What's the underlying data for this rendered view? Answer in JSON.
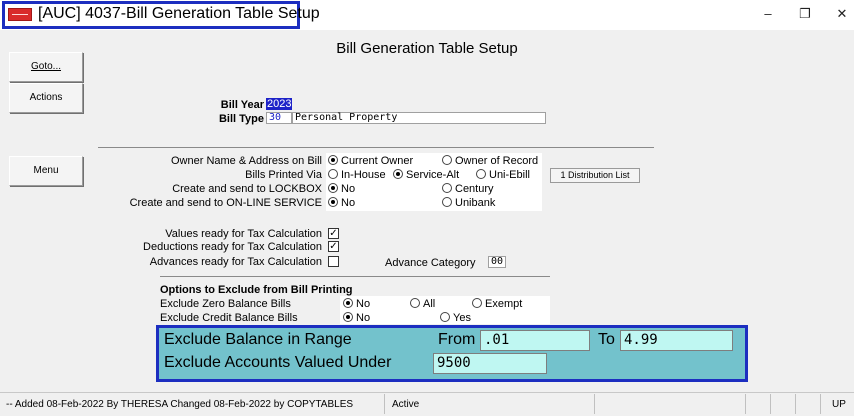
{
  "window": {
    "title": "[AUC] 4037-Bill Generation Table Setup",
    "icon": "app-logo-icon",
    "controls": {
      "minimize": "–",
      "restore": "❐",
      "close": "✕"
    }
  },
  "heading": "Bill Generation Table Setup",
  "side_buttons": {
    "goto": "Goto...",
    "actions": "Actions",
    "menu": "Menu"
  },
  "bill": {
    "year_label": "Bill Year",
    "year_value": "2023",
    "type_label": "Bill Type",
    "type_code": "30",
    "type_desc": "Personal Property"
  },
  "options": {
    "owner": {
      "label": "Owner Name & Address on Bill",
      "choices": [
        "Current Owner",
        "Owner of Record"
      ],
      "selected": 0
    },
    "printed": {
      "label": "Bills Printed Via",
      "choices": [
        "In-House",
        "Service-Alt",
        "Uni-Ebill"
      ],
      "selected": 1
    },
    "lockbox": {
      "label": "Create and send to LOCKBOX",
      "choices": [
        "No",
        "Century"
      ],
      "selected": 0
    },
    "online": {
      "label": "Create and send to ON-LINE SERVICE",
      "choices": [
        "No",
        "Unibank"
      ],
      "selected": 0
    },
    "distribution_button": "1 Distribution List"
  },
  "ready": {
    "values": {
      "label": "Values ready for Tax Calculation",
      "checked": true
    },
    "deductions": {
      "label": "Deductions ready for Tax Calculation",
      "checked": true
    },
    "advances": {
      "label": "Advances ready for Tax Calculation",
      "checked": false
    },
    "advance_category_label": "Advance Category",
    "advance_category_value": "00"
  },
  "exclude": {
    "heading": "Options to Exclude from Bill Printing",
    "zero": {
      "label": "Exclude Zero Balance Bills",
      "choices": [
        "No",
        "All",
        "Exempt"
      ],
      "selected": 0
    },
    "credit": {
      "label": "Exclude Credit Balance Bills",
      "choices": [
        "No",
        "Yes"
      ],
      "selected": 0
    },
    "range_label": "Exclude Balance in Range",
    "from_label": "From",
    "from_value": ".01",
    "to_label": "To",
    "to_value": "4.99",
    "valued_under_label": "Exclude Accounts Valued Under",
    "valued_under_value": "9500"
  },
  "status_bar": {
    "audit": "-- Added 08-Feb-2022 By THERESA Changed 08-Feb-2022 by COPYTABLES",
    "state": "Active",
    "mode": "UP"
  },
  "colors": {
    "highlight_border": "#1c2ec0",
    "range_panel": "#73c2cc",
    "field_fill": "#bff7f2",
    "selection": "#1d22c8"
  }
}
